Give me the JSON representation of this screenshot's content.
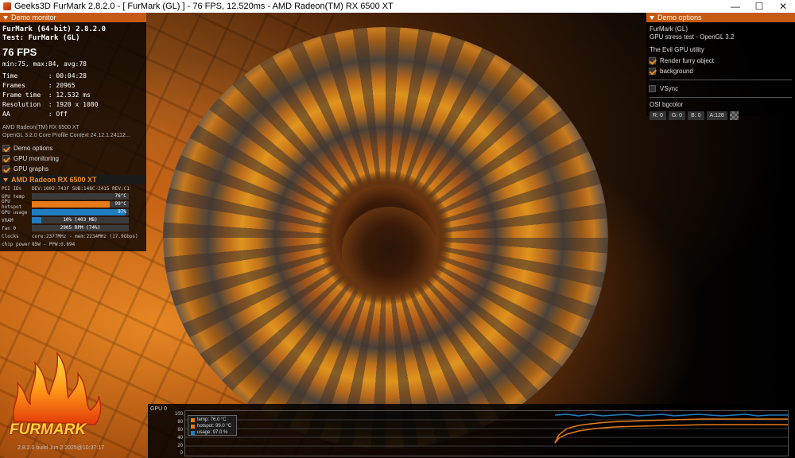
{
  "window": {
    "title": "Geeks3D FurMark 2.8.2.0 - [ FurMark (GL) ] - 76 FPS, 12.520ms - AMD Radeon(TM) RX 6500 XT",
    "minimize": "—",
    "maximize": "☐",
    "close": "✕"
  },
  "demo_monitor": {
    "header": "Demo monitor",
    "line1": "FurMark (64-bit) 2.8.2.0",
    "line2": "Test: FurMark (GL)",
    "fps": "76 FPS",
    "minmax": "min:75, max:84, avg:78",
    "stats": [
      "Time        : 00:04:28",
      "Frames      : 20965",
      "Frame time  : 12.532 ms",
      "Resolution  : 1920 x 1080",
      "AA          : Off"
    ],
    "gpu_name": "AMD Radeon(TM) RX 6500 XT",
    "gl_info": "OpenGL 3.2.0 Core Profile Context 24.12.1.24112...",
    "checkboxes": [
      {
        "label": "Demo options",
        "checked": true
      },
      {
        "label": "GPU monitoring",
        "checked": true
      },
      {
        "label": "GPU graphs",
        "checked": true
      }
    ]
  },
  "gpu_monitor": {
    "header": "AMD Radeon RX 6500 XT",
    "pci_label": "PCI IDs",
    "pci_value": "DEV:1002-743F SUB:148C-2415 REV:C1",
    "rows": [
      {
        "label": "GPU temp",
        "text": "76°C",
        "fraction": 0.72,
        "color": "#3a3a3a"
      },
      {
        "label": "GPU hotspot",
        "text": "99°C",
        "fraction": 0.8,
        "color": "#e67a17"
      },
      {
        "label": "GPU usage",
        "text": "97%",
        "fraction": 0.97,
        "color": "#1f7ec2"
      },
      {
        "label": "VRAM",
        "text": "10% (403 MB)",
        "fraction": 0.1,
        "color": "#1f7ec2"
      },
      {
        "label": "fan 0",
        "text": "2905 RPM (74%)",
        "fraction": 0.74,
        "color": "#3a3a3a"
      }
    ],
    "clocks_label": "Clocks",
    "clocks_value": "core:2377MHz - mem:2234MHz (17.9Gbps)",
    "power_label": "chip power",
    "power_value": "85W - PPW:0.894"
  },
  "demo_options": {
    "header": "Demo options",
    "title": "FurMark (GL)",
    "subtitle": "GPU stress test - OpenGL 3.2",
    "section": "The Evil GPU utility",
    "checkboxes": [
      {
        "label": "Render furry object",
        "checked": true
      },
      {
        "label": "background",
        "checked": true
      }
    ],
    "vsync": {
      "label": "VSync",
      "checked": false
    },
    "osi_label": "OSI bgcolor",
    "osi_values": [
      "R: 0",
      "G: 0",
      "B: 0",
      "A:128"
    ]
  },
  "logo": {
    "text": "FURMARK"
  },
  "build_info": "2.8.2.0 build Jun  2 2025@10:37:17",
  "graph": {
    "label": "GPU 0",
    "yticks": [
      "100",
      "80",
      "60",
      "40",
      "20",
      "0"
    ],
    "legend": [
      {
        "label": "temp: 76.0 °C",
        "color": "#e67a17"
      },
      {
        "label": "hotspot: 99.0 °C",
        "color": "#e67a17"
      },
      {
        "label": "usage: 97.0 %",
        "color": "#1f7ec2"
      }
    ]
  }
}
